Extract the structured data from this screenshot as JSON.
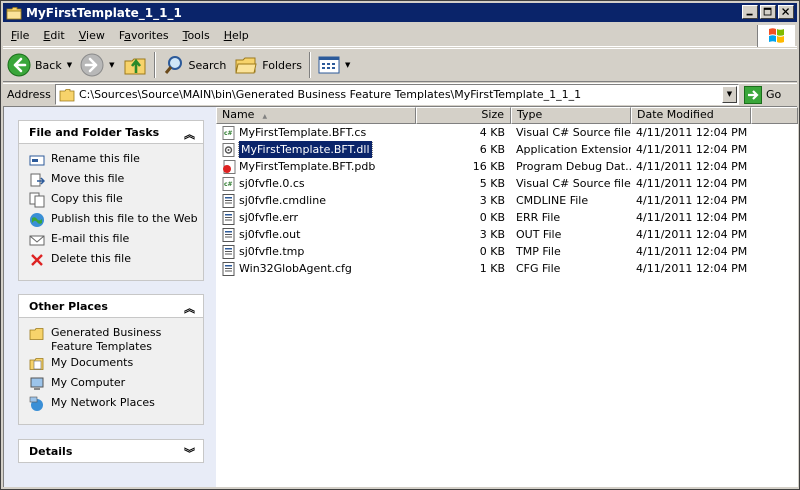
{
  "window": {
    "title": "MyFirstTemplate_1_1_1",
    "icon": "folder-icon"
  },
  "menu": [
    {
      "key": "F",
      "rest": "ile"
    },
    {
      "key": "E",
      "rest": "dit"
    },
    {
      "key": "V",
      "rest": "iew"
    },
    {
      "pre": "F",
      "key": "a",
      "rest": "vorites"
    },
    {
      "key": "T",
      "rest": "ools"
    },
    {
      "key": "H",
      "rest": "elp"
    }
  ],
  "toolbar": {
    "back_label": "Back",
    "search_label": "Search",
    "folders_label": "Folders"
  },
  "address": {
    "label": "Address",
    "value": "C:\\Sources\\Source\\MAIN\\bin\\Generated Business Feature Templates\\MyFirstTemplate_1_1_1",
    "go_label": "Go"
  },
  "left_pane": {
    "file_tasks": {
      "title": "File and Folder Tasks",
      "items": [
        {
          "label": "Rename this file",
          "icon": "rename-icon"
        },
        {
          "label": "Move this file",
          "icon": "move-icon"
        },
        {
          "label": "Copy this file",
          "icon": "copy-icon"
        },
        {
          "label": "Publish this file to the Web",
          "icon": "publish-web-icon"
        },
        {
          "label": "E-mail this file",
          "icon": "email-icon"
        },
        {
          "label": "Delete this file",
          "icon": "delete-icon"
        }
      ]
    },
    "other_places": {
      "title": "Other Places",
      "items": [
        {
          "label": "Generated Business\nFeature Templates",
          "icon": "folder-icon"
        },
        {
          "label": "My Documents",
          "icon": "my-documents-icon"
        },
        {
          "label": "My Computer",
          "icon": "my-computer-icon"
        },
        {
          "label": "My Network Places",
          "icon": "network-places-icon"
        }
      ]
    },
    "details": {
      "title": "Details"
    }
  },
  "file_list": {
    "columns": {
      "name": "Name",
      "size": "Size",
      "type": "Type",
      "date": "Date Modified"
    },
    "rows": [
      {
        "name": "MyFirstTemplate.BFT.cs",
        "size": "4 KB",
        "type": "Visual C# Source file",
        "date": "4/11/2011 12:04 PM",
        "icon": "csharp-file-icon"
      },
      {
        "name": "MyFirstTemplate.BFT.dll",
        "size": "6 KB",
        "type": "Application Extension",
        "date": "4/11/2011 12:04 PM",
        "icon": "dll-file-icon"
      },
      {
        "name": "MyFirstTemplate.BFT.pdb",
        "size": "16 KB",
        "type": "Program Debug Dat...",
        "date": "4/11/2011 12:04 PM",
        "icon": "pdb-file-icon"
      },
      {
        "name": "sj0fvfle.0.cs",
        "size": "5 KB",
        "type": "Visual C# Source file",
        "date": "4/11/2011 12:04 PM",
        "icon": "csharp-file-icon"
      },
      {
        "name": "sj0fvfle.cmdline",
        "size": "3 KB",
        "type": "CMDLINE File",
        "date": "4/11/2011 12:04 PM",
        "icon": "generic-file-icon"
      },
      {
        "name": "sj0fvfle.err",
        "size": "0 KB",
        "type": "ERR File",
        "date": "4/11/2011 12:04 PM",
        "icon": "generic-file-icon"
      },
      {
        "name": "sj0fvfle.out",
        "size": "3 KB",
        "type": "OUT File",
        "date": "4/11/2011 12:04 PM",
        "icon": "generic-file-icon"
      },
      {
        "name": "sj0fvfle.tmp",
        "size": "0 KB",
        "type": "TMP File",
        "date": "4/11/2011 12:04 PM",
        "icon": "generic-file-icon"
      },
      {
        "name": "Win32GlobAgent.cfg",
        "size": "1 KB",
        "type": "CFG File",
        "date": "4/11/2011 12:04 PM",
        "icon": "generic-file-icon"
      }
    ],
    "selected_index": 1
  }
}
